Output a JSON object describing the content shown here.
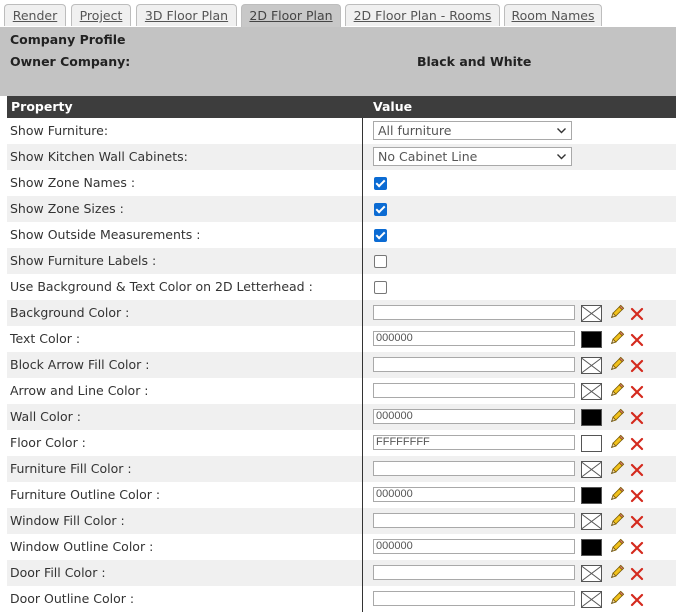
{
  "tabs": [
    "Render",
    "Project",
    "3D Floor Plan",
    "2D Floor Plan",
    "2D Floor Plan - Rooms",
    "Room Names"
  ],
  "profile": {
    "title": "Company Profile",
    "owner_label": "Owner Company:",
    "owner_value": "Black and White"
  },
  "table": {
    "header_property": "Property",
    "header_value": "Value"
  },
  "rows": [
    {
      "label": "Show Furniture:",
      "type": "select",
      "value": "All furniture"
    },
    {
      "label": "Show Kitchen Wall Cabinets:",
      "type": "select",
      "value": "No Cabinet Line"
    },
    {
      "label": "Show Zone Names :",
      "type": "checkbox",
      "checked": true
    },
    {
      "label": "Show Zone Sizes :",
      "type": "checkbox",
      "checked": true
    },
    {
      "label": "Show Outside Measurements :",
      "type": "checkbox",
      "checked": true
    },
    {
      "label": "Show Furniture Labels :",
      "type": "checkbox",
      "checked": false
    },
    {
      "label": "Use Background & Text Color on 2D Letterhead :",
      "type": "checkbox",
      "checked": false
    },
    {
      "label": "Background Color :",
      "type": "color",
      "value": "",
      "swatch": ""
    },
    {
      "label": "Text Color :",
      "type": "color",
      "value": "000000",
      "swatch": "#000000"
    },
    {
      "label": "Block Arrow Fill Color :",
      "type": "color",
      "value": "",
      "swatch": ""
    },
    {
      "label": "Arrow and Line Color :",
      "type": "color",
      "value": "",
      "swatch": ""
    },
    {
      "label": "Wall Color :",
      "type": "color",
      "value": "000000",
      "swatch": "#000000"
    },
    {
      "label": "Floor Color :",
      "type": "color",
      "value": "FFFFFFFF",
      "swatch": "#FFFFFF"
    },
    {
      "label": "Furniture Fill Color :",
      "type": "color",
      "value": "",
      "swatch": ""
    },
    {
      "label": "Furniture Outline Color :",
      "type": "color",
      "value": "000000",
      "swatch": "#000000"
    },
    {
      "label": "Window Fill Color :",
      "type": "color",
      "value": "",
      "swatch": ""
    },
    {
      "label": "Window Outline Color :",
      "type": "color",
      "value": "000000",
      "swatch": "#000000"
    },
    {
      "label": "Door Fill Color :",
      "type": "color",
      "value": "",
      "swatch": ""
    },
    {
      "label": "Door Outline Color :",
      "type": "color",
      "value": "",
      "swatch": ""
    }
  ],
  "icons": {
    "edit": "pencil-icon",
    "clear": "close-icon",
    "empty_swatch": "no-color-icon",
    "dropdown": "chevron-down-icon"
  },
  "colors": {
    "header_bg": "#3d3d3d",
    "profile_bg": "#c3c3c3",
    "checkbox_accent": "#0b6bd3",
    "delete_red": "#d42a1e",
    "pencil_yellow": "#f2c21c"
  }
}
